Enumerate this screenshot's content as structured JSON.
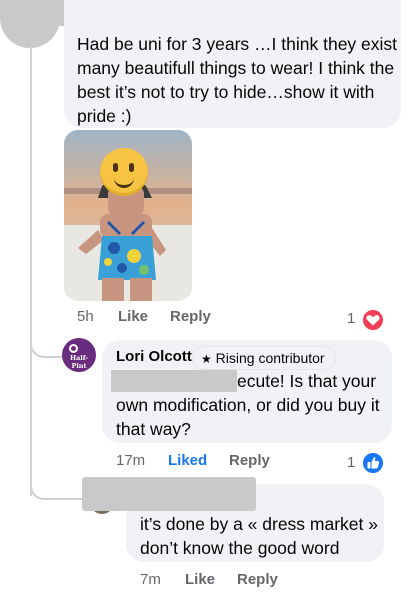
{
  "comments": [
    {
      "text": "Had be uni for 3 years …I think they exist many  beautifull things to wear! I think the best it’s not to try to hide…show it with pride :)",
      "time": "5h",
      "like_label": "Like",
      "reply_label": "Reply",
      "reaction_count": "1",
      "reaction_type": "love"
    },
    {
      "author": "Lori Olcott",
      "badge_label": "Rising contributor",
      "avatar_text": "Half-Pint",
      "text_line1": "ecute!  Is that your",
      "text_line2": "own modification, or did you buy it",
      "text_line3": "that way?",
      "time": "17m",
      "like_label": "Liked",
      "reply_label": "Reply",
      "reaction_count": "1",
      "reaction_type": "like"
    },
    {
      "text_line1": "it’s done by a « dress market »",
      "text_line2": "don’t know the good word",
      "time": "7m",
      "like_label": "Like",
      "reply_label": "Reply"
    }
  ],
  "colors": {
    "bubble": "#f0f2f5",
    "meta_text": "#65676b",
    "liked_blue": "#1877f2",
    "love_red": "#f33e58",
    "thread_line": "#ced0d4",
    "redaction": "#c9c9c9",
    "lori_avatar": "#6a2c7f"
  },
  "icons": [
    "heart-icon",
    "thumbs-up-icon",
    "star-icon",
    "emoji-face-icon"
  ]
}
